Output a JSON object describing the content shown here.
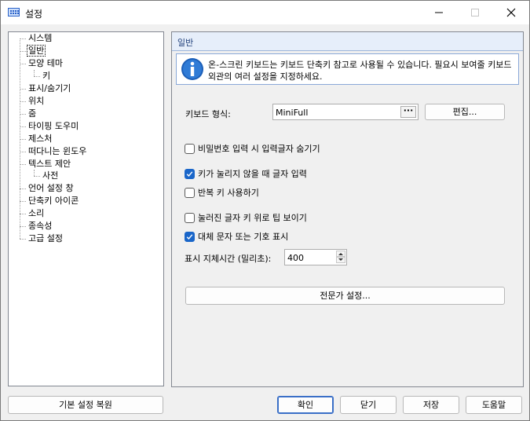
{
  "window": {
    "title": "설정"
  },
  "tree": {
    "items": [
      {
        "label": "시스템"
      },
      {
        "label": "일반"
      },
      {
        "label": "모양 테마"
      },
      {
        "label": "키"
      },
      {
        "label": "표시/숨기기"
      },
      {
        "label": "위치"
      },
      {
        "label": "줌"
      },
      {
        "label": "타이핑 도우미"
      },
      {
        "label": "제스처"
      },
      {
        "label": "떠다니는 윈도우"
      },
      {
        "label": "텍스트 제안"
      },
      {
        "label": "사전"
      },
      {
        "label": "언어 설정 창"
      },
      {
        "label": "단축키 아이콘"
      },
      {
        "label": "소리"
      },
      {
        "label": "종속성"
      },
      {
        "label": "고급 설정"
      }
    ],
    "selected": "일반"
  },
  "panel": {
    "title": "일반",
    "info": "온-스크린 키보드는 키보드 단축키 참고로 사용될 수 있습니다. 필요시 보여줄 키보드 외관의 여러 설정을 지정하세요.",
    "keyboard_label": "키보드 형식:",
    "keyboard_value": "MiniFull",
    "keyboard_more": "···",
    "edit_button": "편집...",
    "checkboxes": [
      {
        "label": "비밀번호 입력 시 입력글자 숨기기",
        "checked": false
      },
      {
        "label": "키가 눌리지 않을 때 글자 입력",
        "checked": true
      },
      {
        "label": "반복 키 사용하기",
        "checked": false
      },
      {
        "label": "눌러진 글자 키 위로 팁 보이기",
        "checked": false
      },
      {
        "label": "대체 문자 또는 기호 표시",
        "checked": true
      }
    ],
    "delay_label": "표시 지체시간 (밀리초):",
    "delay_value": "400",
    "expert_button": "전문가 설정..."
  },
  "footer": {
    "restore": "기본 설정 복원",
    "ok": "확인",
    "close": "닫기",
    "save": "저장",
    "help": "도움말"
  },
  "colors": {
    "accent": "#1a66c9",
    "header_bg": "#e6eefa",
    "window_bg": "#f0f0f0"
  }
}
